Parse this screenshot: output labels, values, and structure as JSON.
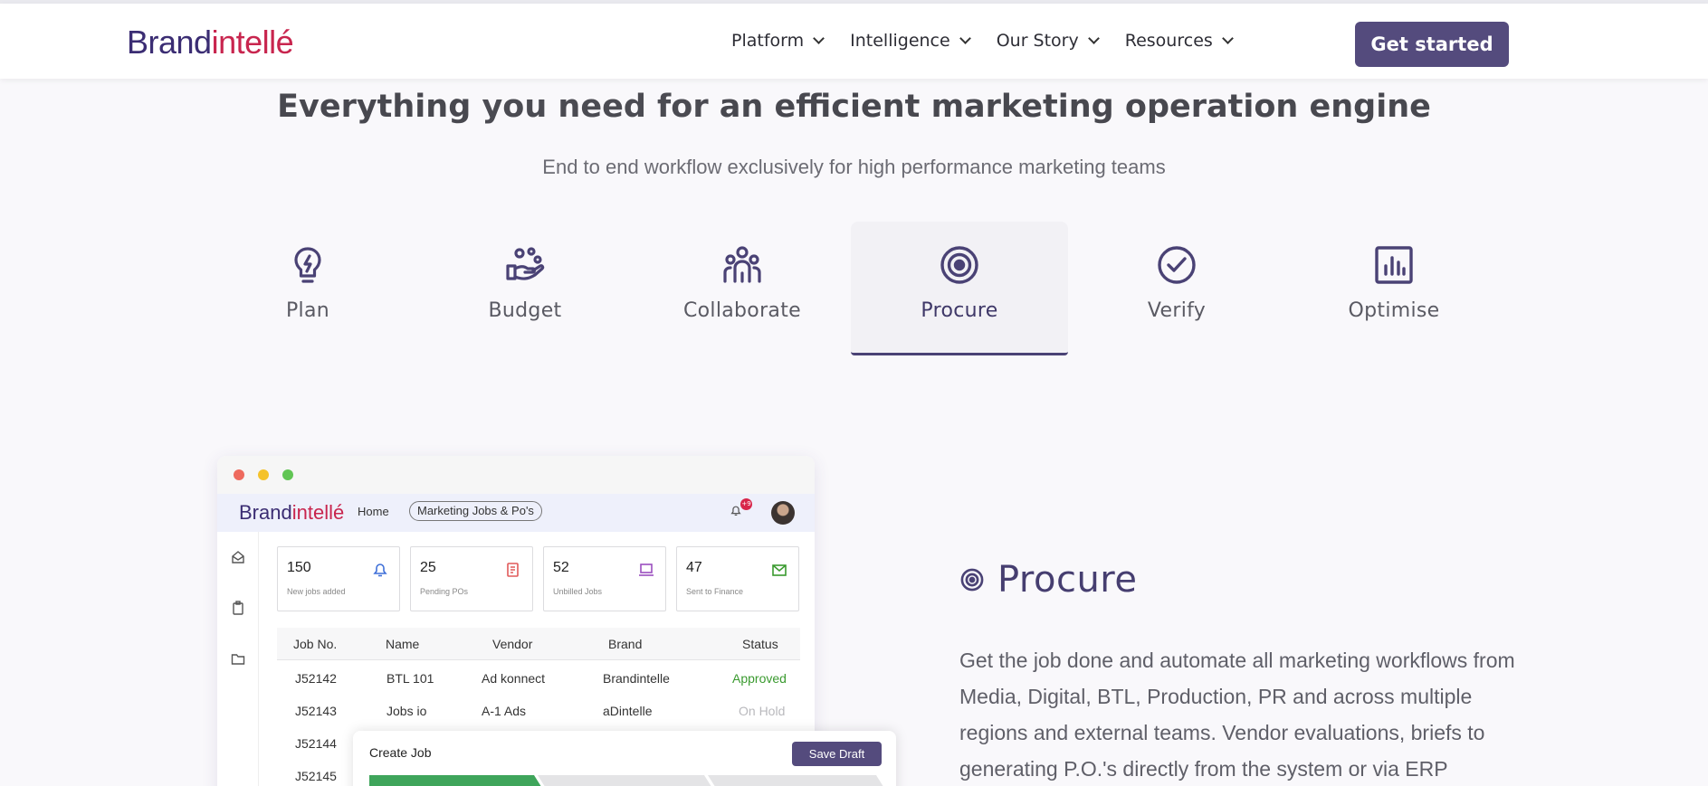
{
  "brand": {
    "part1": "Brand",
    "part2": "intellé",
    "primary_color": "#3b2d73",
    "accent_color": "#c8254e"
  },
  "nav": {
    "items": [
      {
        "label": "Platform",
        "icon": "chevron-down-icon"
      },
      {
        "label": "Intelligence",
        "icon": "chevron-down-icon"
      },
      {
        "label": "Our Story",
        "icon": "chevron-down-icon"
      },
      {
        "label": "Resources",
        "icon": "chevron-down-icon"
      }
    ],
    "cta_label": "Get started",
    "cta_color": "#544b7d"
  },
  "hero": {
    "headline_bold1": "Everything",
    "headline_mid": " you need for ",
    "headline_bold2": "an efficient marketing operation engine",
    "subline": "End to end workflow exclusively for high performance marketing teams"
  },
  "tabs": [
    {
      "label": "Plan",
      "icon": "lightbulb-icon",
      "active": false
    },
    {
      "label": "Budget",
      "icon": "hand-coins-icon",
      "active": false
    },
    {
      "label": "Collaborate",
      "icon": "team-icon",
      "active": false
    },
    {
      "label": "Procure",
      "icon": "target-icon",
      "active": true
    },
    {
      "label": "Verify",
      "icon": "check-circle-icon",
      "active": false
    },
    {
      "label": "Optimise",
      "icon": "bar-chart-icon",
      "active": false
    }
  ],
  "mock": {
    "logo_part1": "Brand",
    "logo_part2": "intellé",
    "home": "Home",
    "breadcrumb": "Marketing Jobs & Po's",
    "notifications": "+9",
    "stats": [
      {
        "value": "150",
        "label": "New jobs added",
        "icon": "bell-icon"
      },
      {
        "value": "25",
        "label": "Pending POs",
        "icon": "document-icon"
      },
      {
        "value": "52",
        "label": "Unbilled Jobs",
        "icon": "laptop-icon"
      },
      {
        "value": "47",
        "label": "Sent to Finance",
        "icon": "mail-icon"
      }
    ],
    "columns": [
      "Job No.",
      "Name",
      "Vendor",
      "Brand",
      "Status"
    ],
    "rows": [
      {
        "job": "J52142",
        "name": "BTL 101",
        "vendor": "Ad konnect",
        "brand": "Brandintelle",
        "status": "Approved"
      },
      {
        "job": "J52143",
        "name": "Jobs io",
        "vendor": "A-1 Ads",
        "brand": "aDintelle",
        "status": "On Hold"
      },
      {
        "job": "J52144"
      },
      {
        "job": "J52145"
      }
    ],
    "create_job": {
      "title": "Create Job",
      "save_label": "Save Draft"
    }
  },
  "section": {
    "icon": "target-icon",
    "title": "Procure",
    "body": "Get the job done and automate all marketing workflows from Media, Digital, BTL, Production, PR and across multiple regions and external teams. Vendor evaluations, briefs to generating P.O.'s directly from the system or via ERP integration. Ensure"
  }
}
